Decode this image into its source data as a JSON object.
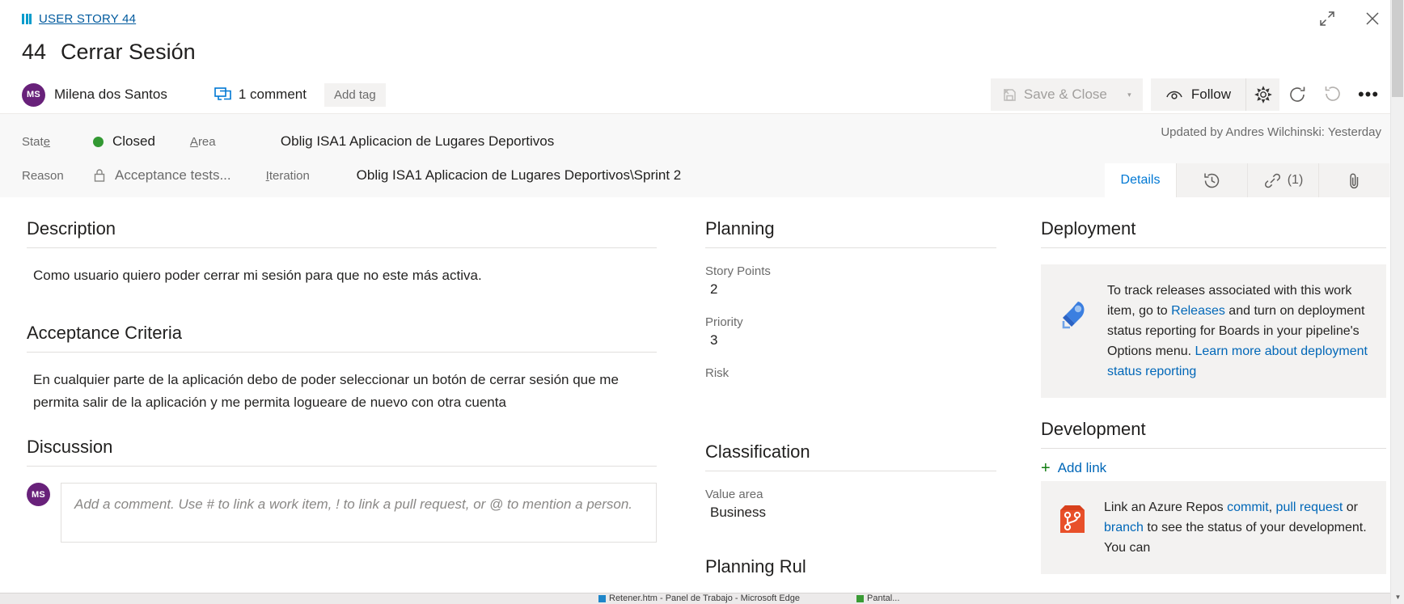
{
  "window": {
    "expand_icon": "expand-arrows-icon",
    "close_icon": "close-icon"
  },
  "header": {
    "breadcrumb_icon": "user-story-icon",
    "breadcrumb_label": "USER STORY 44",
    "work_item_id": "44",
    "work_item_title": "Cerrar Sesión",
    "assignee_initials": "MS",
    "assignee_name": "Milena dos Santos",
    "comment_icon": "comment-icon",
    "comment_count_label": "1 comment",
    "add_tag_label": "Add tag"
  },
  "toolbar": {
    "save_close_label": "Save & Close",
    "save_close_icon": "save-disabled-icon",
    "save_close_caret": "▾",
    "follow_label": "Follow",
    "follow_icon": "eye-icon",
    "gear_icon": "gear-icon",
    "refresh_icon": "refresh-icon",
    "undo_icon": "undo-icon",
    "more_icon": "ellipsis-icon",
    "more_label": "•••"
  },
  "fields": {
    "state_label": "State",
    "state_label_pre": "Stat",
    "state_label_accel": "e",
    "state_value": "Closed",
    "state_color": "#339933",
    "reason_label": "Reason",
    "reason_icon": "lock-icon",
    "reason_value": "Acceptance tests...",
    "area_label_accel": "A",
    "area_label_post": "rea",
    "area_value": "Oblig ISA1 Aplicacion de Lugares Deportivos",
    "iteration_label_accel": "I",
    "iteration_label_post": "teration",
    "iteration_value": "Oblig ISA1 Aplicacion de Lugares Deportivos\\Sprint 2",
    "updated_by": "Updated by Andres Wilchinski: Yesterday"
  },
  "tabs": [
    {
      "label": "Details",
      "icon": "",
      "count": "",
      "active": true
    },
    {
      "label": "",
      "icon": "history-icon",
      "count": "",
      "active": false
    },
    {
      "label": "",
      "icon": "link-icon",
      "count": "(1)",
      "active": false
    },
    {
      "label": "",
      "icon": "attachment-icon",
      "count": "",
      "active": false
    }
  ],
  "description": {
    "title": "Description",
    "text": "Como usuario quiero poder cerrar mi sesión para que no este más activa."
  },
  "acceptance_criteria": {
    "title": "Acceptance Criteria",
    "text": "En cualquier parte de la aplicación debo de poder seleccionar un botón de cerrar sesión que me permita salir de la aplicación y me permita logueare de nuevo con otra cuenta"
  },
  "discussion": {
    "title": "Discussion",
    "avatar_initials": "MS",
    "comment_placeholder": "Add a comment. Use # to link a work item, ! to link a pull request, or @ to mention a person."
  },
  "planning": {
    "title": "Planning",
    "story_points_label": "Story Points",
    "story_points_value": "2",
    "priority_label": "Priority",
    "priority_value": "3",
    "risk_label": "Risk",
    "risk_value": ""
  },
  "classification": {
    "title": "Classification",
    "value_area_label": "Value area",
    "value_area_value": "Business",
    "next_section_partial": "Planning Rul"
  },
  "deployment": {
    "title": "Deployment",
    "icon": "rocket-icon",
    "text_part1": "To track releases associated with this work item, go to ",
    "link_releases": "Releases",
    "text_part2": " and turn on deployment status reporting for Boards in your pipeline's Options menu. ",
    "link_learn_more": "Learn more about deployment status reporting"
  },
  "development": {
    "title": "Development",
    "add_link_label": "Add link",
    "add_link_icon": "plus-icon",
    "icon": "repo-icon",
    "text_part1": "Link an Azure Repos ",
    "link_commit": "commit",
    "text_comma": ", ",
    "link_pull_request": "pull request",
    "text_or": " or ",
    "link_branch": "branch",
    "text_part2": " to see the status of your development. You can"
  },
  "taskbar": {
    "items": [
      {
        "label": "",
        "color": ""
      },
      {
        "label": "",
        "color": ""
      },
      {
        "label": "Retener.htm - Panel de Trabajo - Microsoft Edge",
        "color": "#1f86c9"
      },
      {
        "label": "Pantal...",
        "color": "#3a9b35"
      }
    ]
  },
  "colors": {
    "accent_blue": "#0078d4",
    "link_blue": "#0067b8",
    "state_green": "#339933",
    "avatar_purple": "#68217a"
  },
  "scrollbars": {
    "up_arrow": "▲",
    "down_arrow": "▼"
  }
}
